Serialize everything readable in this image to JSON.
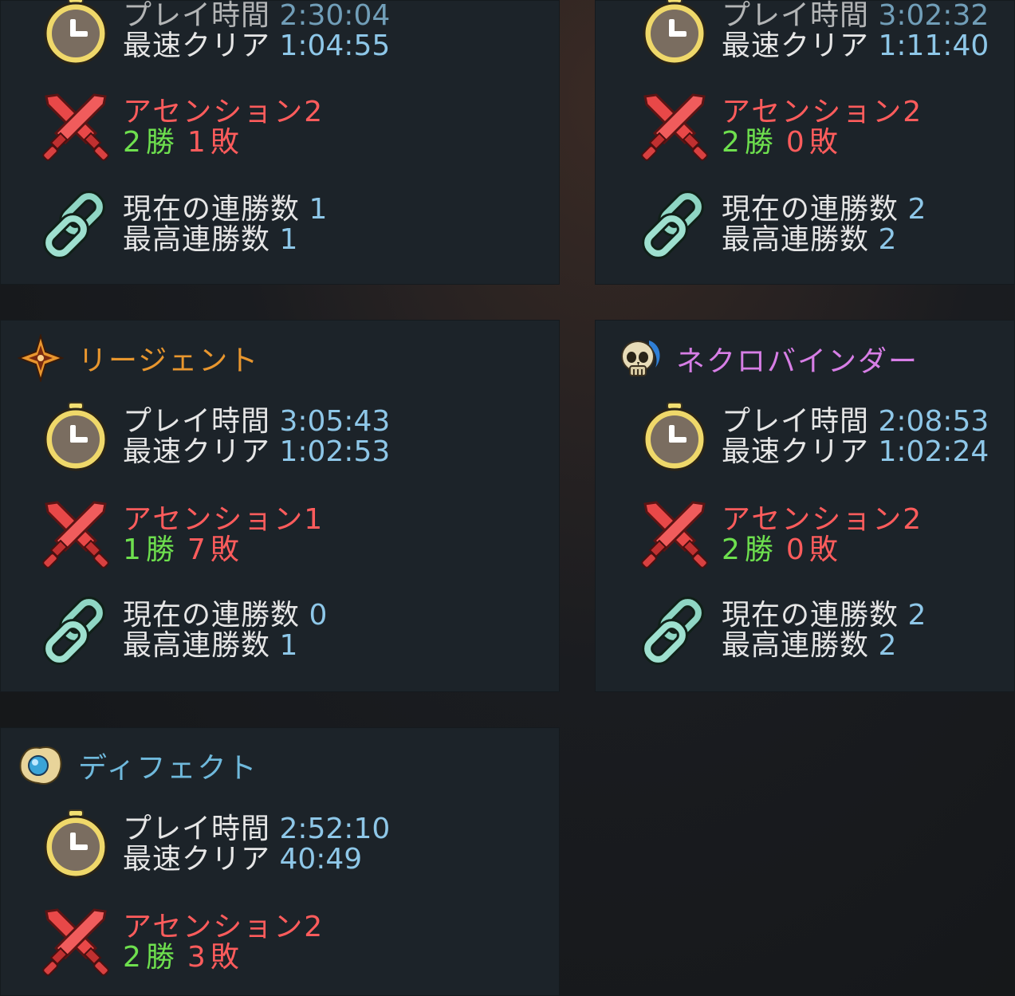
{
  "cards": [
    {
      "name": "",
      "name_color": "",
      "playtime_label": "プレイ時間",
      "playtime": "2:30:04",
      "fastest_label": "最速クリア",
      "fastest": "1:04:55",
      "ascension_label": "アセンション",
      "ascension": "2",
      "wins": "2",
      "win_label": "勝",
      "losses": "1",
      "loss_label": "敗",
      "streak_label": "現在の連勝数",
      "streak": "1",
      "best_streak_label": "最高連勝数",
      "best_streak": "1"
    },
    {
      "name": "",
      "name_color": "",
      "playtime_label": "プレイ時間",
      "playtime": "3:02:32",
      "fastest_label": "最速クリア",
      "fastest": "1:11:40",
      "ascension_label": "アセンション",
      "ascension": "2",
      "wins": "2",
      "win_label": "勝",
      "losses": "0",
      "loss_label": "敗",
      "streak_label": "現在の連勝数",
      "streak": "2",
      "best_streak_label": "最高連勝数",
      "best_streak": "2"
    },
    {
      "name": "リージェント",
      "name_color": "#e8962e",
      "icon": "regent-star-icon",
      "playtime_label": "プレイ時間",
      "playtime": "3:05:43",
      "fastest_label": "最速クリア",
      "fastest": "1:02:53",
      "ascension_label": "アセンション",
      "ascension": "1",
      "wins": "1",
      "win_label": "勝",
      "losses": "7",
      "loss_label": "敗",
      "streak_label": "現在の連勝数",
      "streak": "0",
      "best_streak_label": "最高連勝数",
      "best_streak": "1"
    },
    {
      "name": "ネクロバインダー",
      "name_color": "#d77ee6",
      "icon": "skull-icon",
      "playtime_label": "プレイ時間",
      "playtime": "2:08:53",
      "fastest_label": "最速クリア",
      "fastest": "1:02:24",
      "ascension_label": "アセンション",
      "ascension": "2",
      "wins": "2",
      "win_label": "勝",
      "losses": "0",
      "loss_label": "敗",
      "streak_label": "現在の連勝数",
      "streak": "2",
      "best_streak_label": "最高連勝数",
      "best_streak": "2"
    },
    {
      "name": "ディフェクト",
      "name_color": "#6fb9dc",
      "icon": "orb-icon",
      "playtime_label": "プレイ時間",
      "playtime": "2:52:10",
      "fastest_label": "最速クリア",
      "fastest": "40:49",
      "ascension_label": "アセンション",
      "ascension": "2",
      "wins": "2",
      "win_label": "勝",
      "losses": "3",
      "loss_label": "敗"
    }
  ],
  "colors": {
    "panel": "#1c2329",
    "label": "#e6e6e6",
    "value": "#8ec7e8",
    "ascension": "#ff5c5c",
    "wins": "#6ee04e"
  }
}
